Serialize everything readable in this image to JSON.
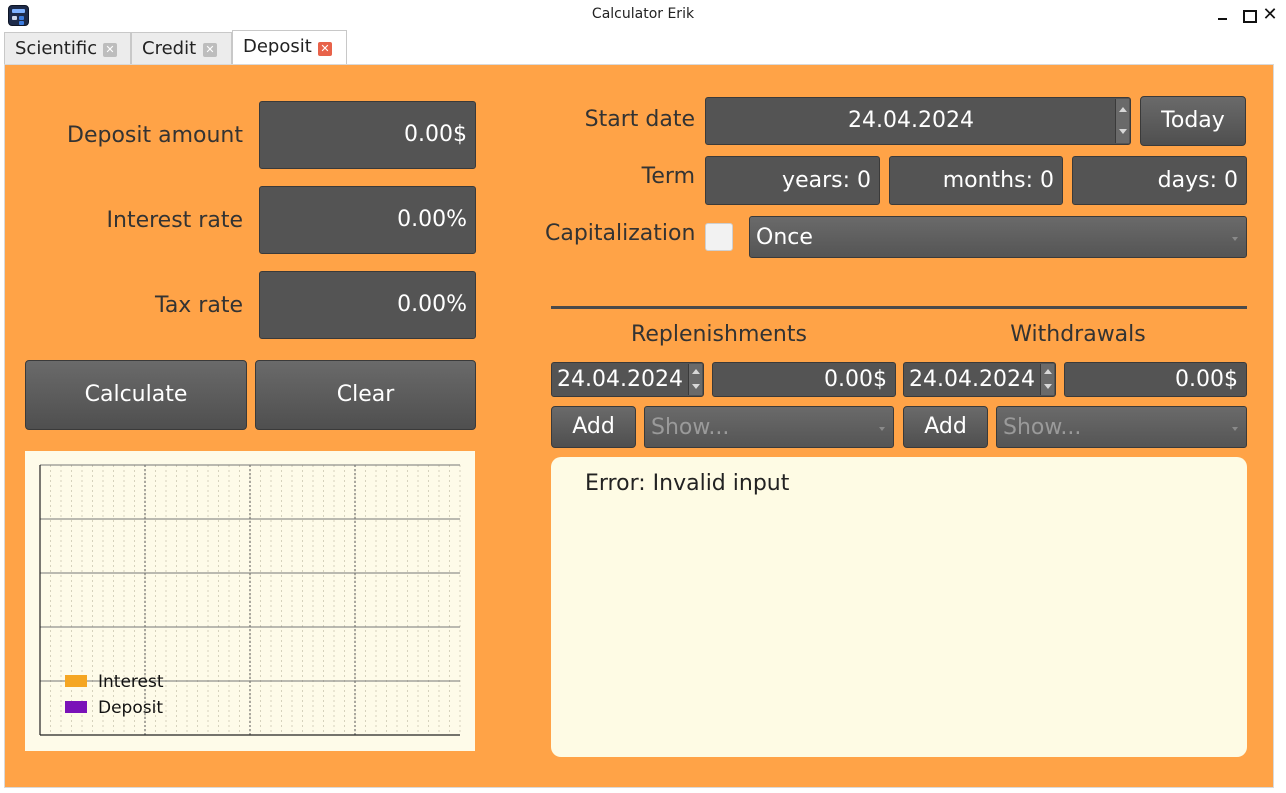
{
  "window": {
    "title": "Calculator Erik",
    "minimize_icon": "minimize-icon",
    "maximize_icon": "maximize-icon",
    "close_glyph": "✕"
  },
  "tabs": [
    {
      "label": "Scientific",
      "close_glyph": "✕",
      "active": false
    },
    {
      "label": "Credit",
      "close_glyph": "✕",
      "active": false
    },
    {
      "label": "Deposit",
      "close_glyph": "✕",
      "active": true
    }
  ],
  "colors": {
    "panel_background": "#ffa347",
    "field_background": "#545454",
    "active_tab_close": "#e8624a",
    "interest_series": "#f5a623",
    "deposit_series": "#7a12b8",
    "output_background": "#fefbe4"
  },
  "deposit_form": {
    "deposit_amount_label": "Deposit amount",
    "deposit_amount_value": "0.00$",
    "interest_rate_label": "Interest rate",
    "interest_rate_value": "0.00%",
    "tax_rate_label": "Tax rate",
    "tax_rate_value": "0.00%",
    "calculate_label": "Calculate",
    "clear_label": "Clear"
  },
  "settings": {
    "start_date_label": "Start date",
    "start_date_value": "24.04.2024",
    "today_label": "Today",
    "term_label": "Term",
    "term_years": "years: 0",
    "term_months": "months: 0",
    "term_days": "days: 0",
    "capitalization_label": "Capitalization",
    "capitalization_checked": false,
    "capitalization_period": "Once"
  },
  "replenishments": {
    "header": "Replenishments",
    "date_value": "24.04.2024",
    "amount_value": "0.00$",
    "add_label": "Add",
    "show_placeholder": "Show..."
  },
  "withdrawals": {
    "header": "Withdrawals",
    "date_value": "24.04.2024",
    "amount_value": "0.00$",
    "add_label": "Add",
    "show_placeholder": "Show..."
  },
  "output": {
    "message": "Error: Invalid input"
  },
  "chart_data": {
    "type": "area",
    "series": [
      {
        "name": "Interest",
        "values": []
      },
      {
        "name": "Deposit",
        "values": []
      }
    ],
    "grid": true,
    "legend_position": "bottom-left"
  }
}
